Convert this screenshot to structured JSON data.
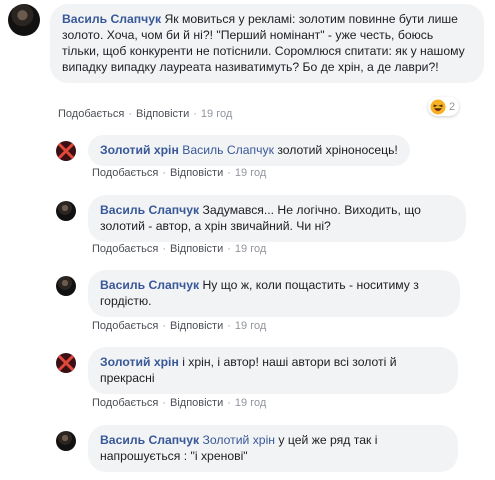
{
  "comments": [
    {
      "author": "Василь Слапчук",
      "text": "Як мовиться у рекламі: золотим повинне бути лише золото. Хоча, чом би й ні?! \"Перший номінант\" - уже честь, боюсь тільки, щоб конкуренти не потіснили. Соромлюся спитати: як у нашому випадку випадку лауреата називатимуть? Бо де хрін, а де лаври?!",
      "reaction_icon": "haha-emoji-icon",
      "reaction_count": "2",
      "like": "Подобається",
      "reply": "Відповісти",
      "time": "19 год"
    }
  ],
  "replies": [
    {
      "author": "Золотий хрін",
      "mention": "Василь Слапчук",
      "text": " золотий хріноносець!",
      "like": "Подобається",
      "reply": "Відповісти",
      "time": "19 год"
    },
    {
      "author": "Василь Слапчук",
      "mention": "",
      "text": " Задумався... Не логічно. Виходить, що золотий - автор, а хрін звичайний. Чи ні?",
      "like": "Подобається",
      "reply": "Відповісти",
      "time": "19 год"
    },
    {
      "author": "Василь Слапчук",
      "mention": "",
      "text": " Ну що ж, коли пощастить - носитиму з гордістю.",
      "like": "Подобається",
      "reply": "Відповісти",
      "time": "19 год"
    },
    {
      "author": "Золотий хрін",
      "mention": "",
      "text": " і хрін, і автор! наші автори всі золоті й прекрасні",
      "like": "Подобається",
      "reply": "Відповісти",
      "time": "19 год"
    },
    {
      "author": "Василь Слапчук",
      "mention": "Золотий хрін",
      "text": " у цей же ряд так і напрошується : \"і хренові\""
    }
  ],
  "separator": "·",
  "colors": {
    "link": "#385898",
    "bubble": "#f2f3f5",
    "meta": "#90949c"
  }
}
